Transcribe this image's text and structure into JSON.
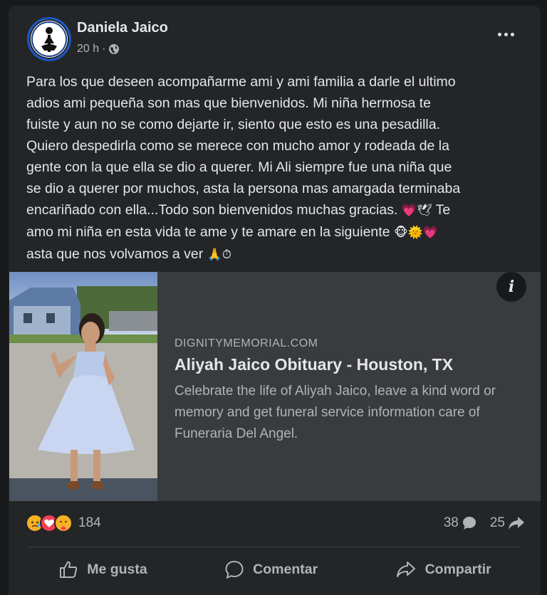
{
  "post": {
    "author": "Daniela Jaico",
    "time": "20 h",
    "separator": "·",
    "privacy_icon": "globe-icon",
    "text_lines": [
      "Para los que deseen acompañarme ami y ami familia a darle el ultimo",
      "adios ami pequeña son mas que bienvenidos. Mi niña hermosa te",
      "fuiste y aun no se como dejarte ir, siento que esto es una pesadilla.",
      "Quiero despedirla como se merece con mucho amor y rodeada de la",
      "gente con la que ella se dio a querer. Mi Ali siempre fue una niña que",
      "se dio a querer por muchos, asta la persona mas amargada terminaba",
      "encariñado con ella...Todo son bienvenidos muchas gracias.",
      "Te",
      "amo mi niña en esta vida te ame y te amare en la siguiente",
      "asta que nos volvamos a ver"
    ],
    "emojis": {
      "line7": "💗🕊",
      "line9": "🐵🌞💗",
      "line10": "🙏⏱"
    }
  },
  "link_preview": {
    "domain": "DIGNITYMEMORIAL.COM",
    "title": "Aliyah Jaico Obituary - Houston, TX",
    "description": "Celebrate the life of Aliyah Jaico, leave a kind word or memory and get funeral service information care of Funeraria Del Angel.",
    "info_label": "i"
  },
  "engagement": {
    "reaction_icons": [
      "sad-react-icon",
      "love-react-icon",
      "care-react-icon"
    ],
    "reaction_count": "184",
    "comment_count": "38",
    "share_count": "25"
  },
  "actions": {
    "like_label": "Me gusta",
    "comment_label": "Comentar",
    "share_label": "Compartir"
  },
  "colors": {
    "background": "#18191a",
    "card": "#242526",
    "preview": "#3a3b3c",
    "text_primary": "#e4e6eb",
    "text_secondary": "#b0b3b8"
  }
}
